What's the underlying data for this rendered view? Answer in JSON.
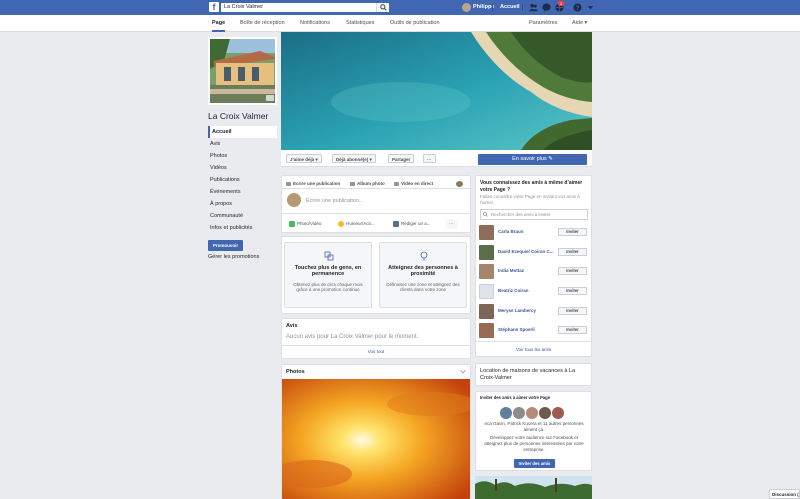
{
  "topbar": {
    "search_value": "La Croix Valmer",
    "user_name": "Philippe",
    "home_label": "Accueil",
    "notification_count": "1"
  },
  "page_nav": {
    "tabs": [
      "Page",
      "Boîte de réception",
      "Notifications",
      "Statistiques",
      "Outils de publication"
    ],
    "settings": "Paramètres",
    "help": "Aide ▾"
  },
  "left": {
    "page_name": "La Croix Valmer",
    "nav": [
      "Accueil",
      "Avis",
      "Photos",
      "Vidéos",
      "Publications",
      "Événements",
      "À propos",
      "Communauté",
      "Infos et publicités"
    ],
    "promote": "Promouvoir",
    "manage_promotions": "Gérer les promotions"
  },
  "actions": {
    "like": "J’aime déjà ▾",
    "follow": "Déjà abonné(e) ▾",
    "share": "Partager",
    "more": "···",
    "learn_more": "En savoir plus ✎"
  },
  "composer": {
    "tab_write": "Écrire une publication",
    "tab_album": "Album photo",
    "tab_live": "Vidéo en direct",
    "placeholder": "Écrire une publication...",
    "chip_photo": "Photo/Vidéo",
    "chip_mood": "Humeur/Acti...",
    "chip_note": "Rédiger un a...",
    "chip_more": "···"
  },
  "promos": [
    {
      "title": "Touchez plus de gens, en permanence",
      "desc": "Obtenez plus de clics chaque mois grâce à une promotion continue"
    },
    {
      "title": "Atteignez des personnes à proximité",
      "desc": "Définissez une zone et atteignez des clients dans votre zone"
    }
  ],
  "reviews": {
    "title": "Avis",
    "empty": "Aucun avis pour La Croix Valmer pour le moment.",
    "see_all": "Voir tout"
  },
  "photos": {
    "title": "Photos"
  },
  "invite": {
    "title": "Vous connaissez des amis à même d’aimer votre Page ?",
    "desc": "Faites connaître votre Page en invitant vos amis à l’aimer.",
    "search_placeholder": "Rechercher des amis à inviter",
    "button": "Inviter",
    "friends": [
      "Carla Braun",
      "David Ezequiel Coiran C...",
      "India Mottaz",
      "Beatriz Coiran",
      "Meryse Lambercy",
      "Stéphane Spoerli"
    ],
    "see_all": "Voir tous les amis"
  },
  "category": {
    "text": "Location de maisons de vacances à La Croix-Valmer"
  },
  "invite2": {
    "title": "Inviter des amis à aimer votre Page",
    "likes": "Irca Gavin, Patrick Kucera et 11 autres personnes aiment ça.",
    "develop": "Développez votre audience sur Facebook et atteignez plus de personnes intéressées par votre entreprise.",
    "button": "Inviter des amis"
  },
  "chat": {
    "label": "Discussion ("
  },
  "colors": {
    "brand": "#4267b2",
    "link": "#385898",
    "background": "#e9ebee"
  }
}
